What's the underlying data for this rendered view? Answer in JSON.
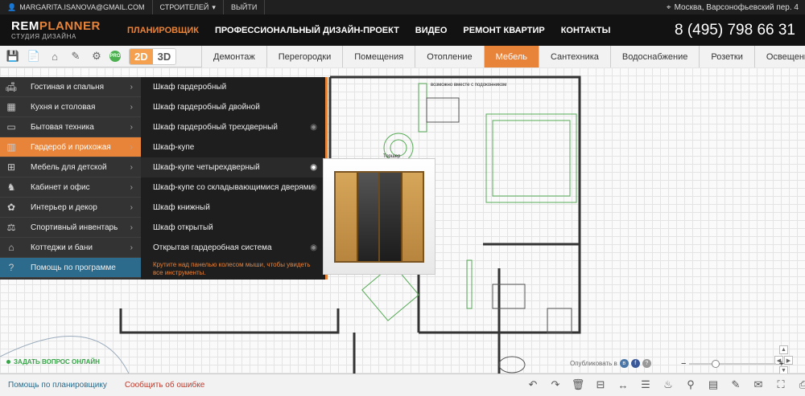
{
  "topbar": {
    "email": "MARGARITA.ISANOVA@GMAIL.COM",
    "role": "СТРОИТЕЛЕЙ",
    "logout": "ВЫЙТИ",
    "location": "Москва, Варсонофьевский пер. 4"
  },
  "header": {
    "logo_a": "REM",
    "logo_b": "PLANNER",
    "logo_sub": "СТУДИЯ ДИЗАЙНА",
    "nav": [
      "ПЛАНИРОВЩИК",
      "ПРОФЕССИОНАЛЬНЫЙ ДИЗАЙН-ПРОЕКТ",
      "ВИДЕО",
      "РЕМОНТ КВАРТИР",
      "КОНТАКТЫ"
    ],
    "phone": "8 (495) 798 66 31"
  },
  "toolbar": {
    "pro": "PRO",
    "mode2d": "2D",
    "mode3d": "3D"
  },
  "categories": [
    "Демонтаж",
    "Перегородки",
    "Помещения",
    "Отопление",
    "Мебель",
    "Сантехника",
    "Водоснабжение",
    "Розетки",
    "Освещение"
  ],
  "menu_primary": [
    {
      "label": "Гостиная и спальня",
      "icon": "sofa-icon"
    },
    {
      "label": "Кухня и столовая",
      "icon": "kitchen-icon"
    },
    {
      "label": "Бытовая техника",
      "icon": "tv-icon"
    },
    {
      "label": "Гардероб и прихожая",
      "icon": "wardrobe-icon"
    },
    {
      "label": "Мебель для детской",
      "icon": "crib-icon"
    },
    {
      "label": "Кабинет и офис",
      "icon": "office-chair-icon"
    },
    {
      "label": "Интерьер и декор",
      "icon": "plant-icon"
    },
    {
      "label": "Спортивный инвентарь",
      "icon": "dumbbell-icon"
    },
    {
      "label": "Коттеджи и бани",
      "icon": "house-icon"
    },
    {
      "label": "Помощь по программе",
      "icon": "help-icon"
    }
  ],
  "menu_secondary": [
    "Шкаф гардеробный",
    "Шкаф гардеробный двойной",
    "Шкаф гардеробный трехдверный",
    "Шкаф-купе",
    "Шкаф-купе четырехдверный",
    "Шкаф-купе со складывающимися дверями",
    "Шкаф книжный",
    "Шкаф открытый",
    "Открытая гардеробная система"
  ],
  "menu_hint": "Крутите над панелью колесом мыши, чтобы увидеть все инструменты.",
  "canvas": {
    "note": "возможно вместе с подоконником",
    "torsher": "Торшер"
  },
  "ask_question": "ЗАДАТЬ ВОПРОС ОНЛАЙН",
  "publish": "Опубликовать в",
  "bottom": {
    "help": "Помощь по планировщику",
    "report": "Сообщить об ошибке"
  }
}
